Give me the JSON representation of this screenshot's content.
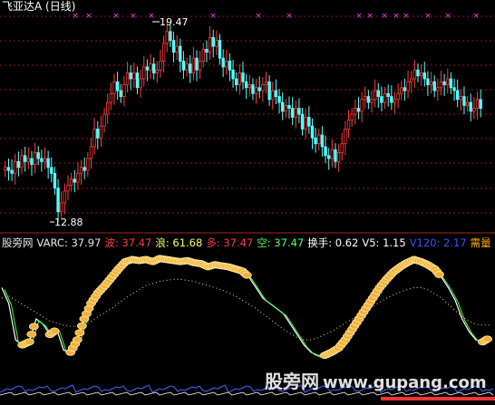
{
  "title": "飞亚达A (日线)",
  "price_chart": {
    "high_label": "19.47",
    "low_label": "12.88",
    "colors": {
      "up": "#ff3b3b",
      "down": "#54ffff",
      "grid": "#8a1b1b",
      "marker": "#ff33ff",
      "background": "#000000"
    }
  },
  "indicator": {
    "items": [
      {
        "text": "股旁网",
        "color": "#e8e8e8"
      },
      {
        "text": "VARC: 37.97",
        "color": "#e8e8e8"
      },
      {
        "text": "波: 37.47",
        "color": "#ff3b3b"
      },
      {
        "text": "浪: 61.68",
        "color": "#ffff55"
      },
      {
        "text": "多: 37.47",
        "color": "#ff3b3b"
      },
      {
        "text": "空: 37.47",
        "color": "#55ff55"
      },
      {
        "text": "换手: 0.62",
        "color": "#ffffff"
      },
      {
        "text": "V5: 1.15",
        "color": "#ffffff"
      },
      {
        "text": "V120: 2.17",
        "color": "#3355ff"
      },
      {
        "text": "需量",
        "color": "#ffaa00"
      }
    ]
  },
  "watermark": {
    "cn": "股旁网",
    "url": "www.gupang.com"
  },
  "chart_data": [
    {
      "type": "candlestick",
      "title": "飞亚达A (日线)",
      "annotations": [
        "19.47",
        "12.88"
      ],
      "close": [
        14.6,
        14.5,
        14.4,
        14.8,
        14.6,
        15.0,
        14.8,
        14.9,
        14.7,
        15.1,
        14.9,
        14.8,
        14.9,
        14.6,
        14.4,
        13.9,
        13.1,
        13.4,
        13.8,
        14.0,
        14.2,
        14.1,
        14.4,
        14.6,
        14.5,
        14.9,
        15.3,
        15.9,
        15.6,
        16.0,
        16.4,
        16.8,
        17.1,
        17.5,
        17.2,
        17.0,
        17.4,
        17.8,
        17.6,
        17.8,
        17.3,
        17.6,
        18.0,
        17.9,
        18.1,
        17.8,
        17.9,
        18.2,
        18.8,
        19.2,
        18.9,
        18.5,
        18.7,
        18.2,
        17.9,
        18.1,
        17.8,
        18.3,
        17.9,
        18.2,
        18.6,
        18.5,
        19.0,
        18.7,
        18.9,
        18.3,
        18.0,
        18.2,
        17.9,
        17.6,
        17.4,
        17.8,
        17.5,
        17.3,
        17.4,
        17.1,
        17.3,
        17.2,
        17.4,
        17.5,
        16.9,
        17.2,
        17.0,
        16.8,
        16.5,
        16.7,
        16.6,
        16.3,
        16.6,
        16.4,
        15.9,
        16.3,
        16.0,
        15.6,
        15.4,
        15.7,
        15.3,
        15.0,
        14.9,
        15.2,
        14.8,
        15.1,
        15.4,
        15.9,
        16.2,
        16.4,
        16.6,
        16.5,
        16.9,
        17.0,
        16.8,
        16.9,
        17.2,
        17.0,
        16.8,
        17.1,
        17.0,
        16.8,
        16.9,
        17.1,
        17.3,
        17.2,
        17.5,
        17.6,
        17.9,
        17.7,
        17.8,
        17.6,
        17.4,
        17.5,
        17.2,
        17.3,
        17.5,
        17.4,
        17.6,
        17.3,
        17.2,
        16.9,
        17.0,
        16.7,
        16.8,
        16.5,
        16.6,
        16.9,
        16.6
      ],
      "high": 19.47,
      "low": 12.88
    },
    {
      "type": "line",
      "series": [
        {
          "name": "VARC",
          "values": [
            70,
            55,
            20,
            15,
            18,
            40,
            35,
            25,
            30,
            10,
            8,
            20,
            40,
            55,
            65,
            72,
            80,
            88,
            95,
            97,
            96,
            97,
            95,
            98,
            97,
            96,
            95,
            96,
            94,
            93,
            90,
            92,
            91,
            90,
            88,
            86,
            80,
            70,
            60,
            55,
            50,
            45,
            35,
            25,
            15,
            8,
            5,
            5,
            8,
            12,
            20,
            30,
            40,
            50,
            60,
            70,
            78,
            85,
            90,
            94,
            97,
            95,
            92,
            88,
            80,
            70,
            58,
            40,
            28,
            20,
            18,
            22
          ]
        },
        {
          "name": "浪",
          "values": [
            60,
            62,
            58,
            54,
            50,
            46,
            42,
            38,
            36,
            34,
            33,
            33,
            35,
            38,
            42,
            46,
            50,
            55,
            60,
            64,
            68,
            72,
            74,
            76,
            77,
            78,
            78,
            77,
            76,
            74,
            72,
            70,
            68,
            65,
            62,
            58,
            54,
            50,
            45,
            40,
            35,
            30,
            26,
            22,
            20,
            20,
            22,
            25,
            28,
            32,
            36,
            40,
            44,
            48,
            52,
            56,
            60,
            63,
            66,
            68,
            70,
            70,
            68,
            64,
            60,
            54,
            48,
            42,
            38,
            35,
            34,
            34
          ]
        }
      ]
    }
  ]
}
